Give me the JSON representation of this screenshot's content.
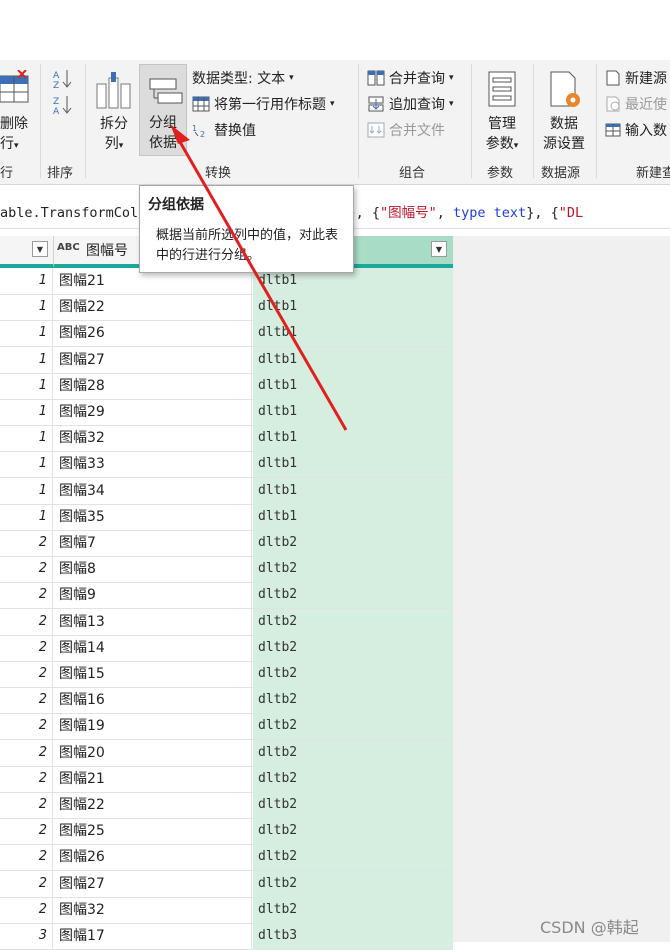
{
  "ribbon": {
    "remove_rows": {
      "line1": "删除",
      "line2": "行",
      "caret": "▾"
    },
    "group_rows_tail": "行",
    "group_sort": "排序",
    "split_column": {
      "line1": "拆分",
      "line2": "列",
      "caret": "▾"
    },
    "group_by": {
      "line1": "分组",
      "line2": "依据"
    },
    "data_type": {
      "label": "数据类型: 文本",
      "caret": "▾"
    },
    "use_first_row": {
      "label": "将第一行用作标题",
      "caret": "▾"
    },
    "replace_values": {
      "label": "替换值"
    },
    "group_transform": "转换",
    "merge_queries": {
      "label": "合并查询",
      "caret": "▾"
    },
    "append_queries": {
      "label": "追加查询",
      "caret": "▾"
    },
    "combine_files": {
      "label": "合并文件"
    },
    "group_combine": "组合",
    "manage_params": {
      "line1": "管理",
      "line2": "参数",
      "caret": "▾"
    },
    "group_params": "参数",
    "data_source_settings": {
      "line1": "数据",
      "line2": "源设置"
    },
    "group_datasource": "数据源",
    "new_source": {
      "label": "新建源"
    },
    "recent_sources": {
      "label": "最近使"
    },
    "enter_data": {
      "label": "输入数"
    },
    "group_new": "新建查"
  },
  "formula": {
    "part1": "able.TransformColu",
    "part2": "nt64.Type}, {",
    "str1": "\"图幅号\"",
    "part3": ", ",
    "kw1": "type",
    "part4": " ",
    "kw2": "text",
    "part5": "}, {",
    "str2": "\"DL"
  },
  "tooltip": {
    "title": "分组依据",
    "body": "概据当前所选列中的值，对此表中的行进行分组。"
  },
  "columns": {
    "col2_type": "ABC",
    "col2_name": "图幅号"
  },
  "rows": [
    {
      "n": "1",
      "fh": "图幅21",
      "dl": "dltb1"
    },
    {
      "n": "1",
      "fh": "图幅22",
      "dl": "dltb1"
    },
    {
      "n": "1",
      "fh": "图幅26",
      "dl": "dltb1"
    },
    {
      "n": "1",
      "fh": "图幅27",
      "dl": "dltb1"
    },
    {
      "n": "1",
      "fh": "图幅28",
      "dl": "dltb1"
    },
    {
      "n": "1",
      "fh": "图幅29",
      "dl": "dltb1"
    },
    {
      "n": "1",
      "fh": "图幅32",
      "dl": "dltb1"
    },
    {
      "n": "1",
      "fh": "图幅33",
      "dl": "dltb1"
    },
    {
      "n": "1",
      "fh": "图幅34",
      "dl": "dltb1"
    },
    {
      "n": "1",
      "fh": "图幅35",
      "dl": "dltb1"
    },
    {
      "n": "2",
      "fh": "图幅7",
      "dl": "dltb2"
    },
    {
      "n": "2",
      "fh": "图幅8",
      "dl": "dltb2"
    },
    {
      "n": "2",
      "fh": "图幅9",
      "dl": "dltb2"
    },
    {
      "n": "2",
      "fh": "图幅13",
      "dl": "dltb2"
    },
    {
      "n": "2",
      "fh": "图幅14",
      "dl": "dltb2"
    },
    {
      "n": "2",
      "fh": "图幅15",
      "dl": "dltb2"
    },
    {
      "n": "2",
      "fh": "图幅16",
      "dl": "dltb2"
    },
    {
      "n": "2",
      "fh": "图幅19",
      "dl": "dltb2"
    },
    {
      "n": "2",
      "fh": "图幅20",
      "dl": "dltb2"
    },
    {
      "n": "2",
      "fh": "图幅21",
      "dl": "dltb2"
    },
    {
      "n": "2",
      "fh": "图幅22",
      "dl": "dltb2"
    },
    {
      "n": "2",
      "fh": "图幅25",
      "dl": "dltb2"
    },
    {
      "n": "2",
      "fh": "图幅26",
      "dl": "dltb2"
    },
    {
      "n": "2",
      "fh": "图幅27",
      "dl": "dltb2"
    },
    {
      "n": "2",
      "fh": "图幅32",
      "dl": "dltb2"
    },
    {
      "n": "3",
      "fh": "图幅17",
      "dl": "dltb3"
    }
  ],
  "watermark": "CSDN @韩起",
  "colors": {
    "accent_teal": "#1aa99b",
    "selected_col": "#d6eedf",
    "arrow_red": "#e02020"
  }
}
